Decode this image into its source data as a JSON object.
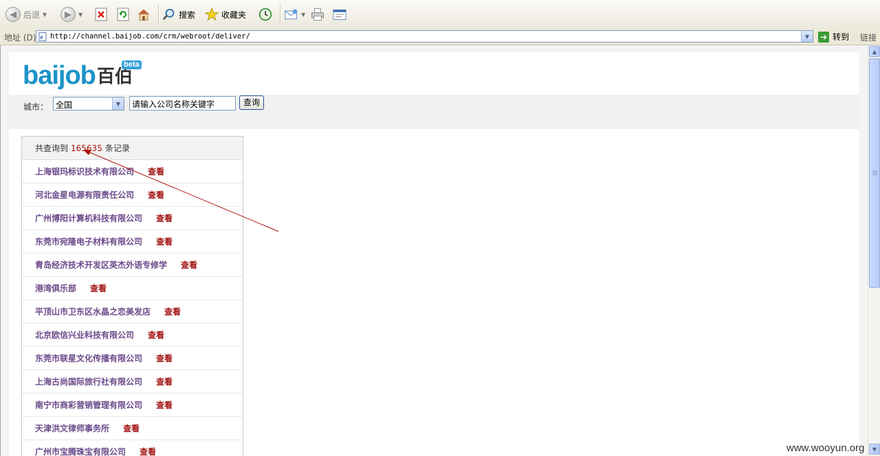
{
  "toolbar": {
    "back_label": "后退",
    "search_label": "搜索",
    "favorites_label": "收藏夹"
  },
  "address_bar": {
    "label": "地址 (D)",
    "url": "http://channel.baijob.com/crm/webroot/deliver/",
    "go_label": "转到",
    "links_label": "链接"
  },
  "logo": {
    "text_en": "baijob",
    "text_cn": "百伯",
    "badge": "beta"
  },
  "search": {
    "city_label": "城市：",
    "city_value": "全国",
    "keyword_value": "请输入公司名称关键字",
    "button_label": "查询"
  },
  "results": {
    "prefix": "共查询到",
    "count": "165635",
    "suffix": "条记录",
    "view_label": "查看",
    "items": [
      {
        "company": "上海银玛标识技术有限公司"
      },
      {
        "company": "河北金星电源有限责任公司"
      },
      {
        "company": "广州博阳计算机科技有限公司"
      },
      {
        "company": "东莞市宛隆电子材料有限公司"
      },
      {
        "company": "青岛经济技术开发区英杰外语专修学"
      },
      {
        "company": "港湾俱乐部"
      },
      {
        "company": "平顶山市卫东区水晶之恋美发店"
      },
      {
        "company": "北京欧信兴业科技有限公司"
      },
      {
        "company": "东莞市联星文化传播有限公司"
      },
      {
        "company": "上海古尚国际旅行社有限公司"
      },
      {
        "company": "南宁市商彩营销管理有限公司"
      },
      {
        "company": "天津洪文律师事务所"
      },
      {
        "company": "广州市宝腾珠宝有限公司"
      }
    ]
  },
  "colors": {
    "annotation_arrow": "#b01010",
    "company_link": "#6b4a8a",
    "view_link": "#a31515",
    "logo_blue": "#1c93c8"
  },
  "watermark": "www.wooyun.org"
}
